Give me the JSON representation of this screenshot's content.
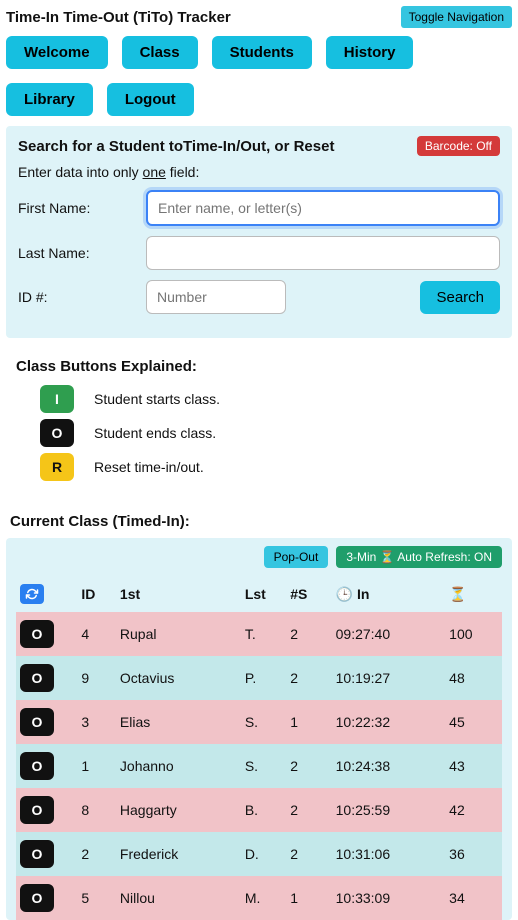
{
  "app_title": "Time-In Time-Out (TiTo) Tracker",
  "toggle_nav": "Toggle Navigation",
  "nav": {
    "welcome": "Welcome",
    "class": "Class",
    "students": "Students",
    "history": "History",
    "library": "Library",
    "logout": "Logout"
  },
  "search_panel": {
    "title": "Search for a Student toTime-In/Out, or Reset",
    "barcode": "Barcode: Off",
    "hint_prefix": "Enter data into only ",
    "hint_underlined": "one",
    "hint_suffix": " field:",
    "first_name_label": "First Name:",
    "first_name_placeholder": "Enter name, or letter(s)",
    "last_name_label": "Last Name:",
    "id_label": "ID #:",
    "id_placeholder": "Number",
    "search_btn": "Search"
  },
  "legend": {
    "title": "Class Buttons Explained:",
    "items": [
      {
        "code": "I",
        "class": "btn-i",
        "text": "Student starts class."
      },
      {
        "code": "O",
        "class": "btn-o",
        "text": "Student ends class."
      },
      {
        "code": "R",
        "class": "btn-r",
        "text": "Reset time-in/out."
      }
    ]
  },
  "current_class": {
    "title": "Current Class (Timed-In):",
    "popout": "Pop-Out",
    "refresh": "3-Min ⏳ Auto Refresh: ON",
    "headers": {
      "id": "ID",
      "first": "1st",
      "lst": "Lst",
      "s": "#S",
      "in": "🕒 In",
      "dur": "⏳"
    },
    "rows": [
      {
        "btn": "O",
        "id": "4",
        "first": "Rupal",
        "lst": "T.",
        "s": "2",
        "in": "09:27:40",
        "dur": "100",
        "cls": "pink"
      },
      {
        "btn": "O",
        "id": "9",
        "first": "Octavius",
        "lst": "P.",
        "s": "2",
        "in": "10:19:27",
        "dur": "48",
        "cls": "teal"
      },
      {
        "btn": "O",
        "id": "3",
        "first": "Elias",
        "lst": "S.",
        "s": "1",
        "in": "10:22:32",
        "dur": "45",
        "cls": "pink"
      },
      {
        "btn": "O",
        "id": "1",
        "first": "Johanno",
        "lst": "S.",
        "s": "2",
        "in": "10:24:38",
        "dur": "43",
        "cls": "teal"
      },
      {
        "btn": "O",
        "id": "8",
        "first": "Haggarty",
        "lst": "B.",
        "s": "2",
        "in": "10:25:59",
        "dur": "42",
        "cls": "pink"
      },
      {
        "btn": "O",
        "id": "2",
        "first": "Frederick",
        "lst": "D.",
        "s": "2",
        "in": "10:31:06",
        "dur": "36",
        "cls": "teal"
      },
      {
        "btn": "O",
        "id": "5",
        "first": "Nillou",
        "lst": "M.",
        "s": "1",
        "in": "10:33:09",
        "dur": "34",
        "cls": "pink"
      }
    ]
  }
}
